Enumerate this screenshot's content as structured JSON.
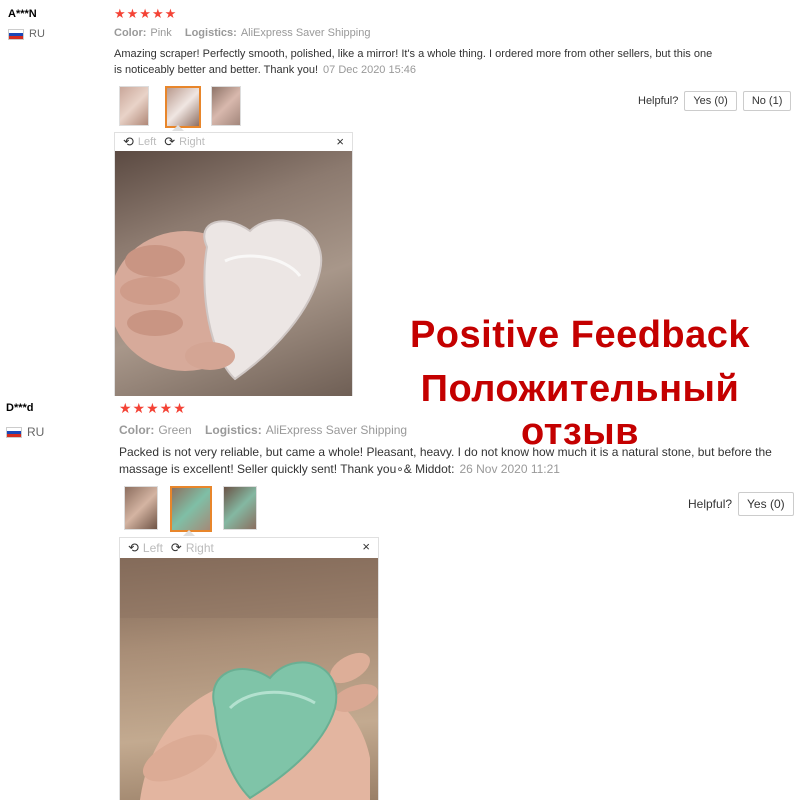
{
  "reviews": [
    {
      "user": "A***N",
      "country": "RU",
      "stars": "★★★★★",
      "color_label": "Color:",
      "color_value": "Pink",
      "logistics_label": "Logistics:",
      "logistics_value": "AliExpress Saver Shipping",
      "text": "Amazing scraper! Perfectly smooth, polished, like a mirror! It's a whole thing. I ordered more from other sellers, but this one is noticeably better and better. Thank you!",
      "date": "07 Dec 2020 15:46",
      "helpful_label": "Helpful?",
      "yes_label": "Yes (0)",
      "no_label": "No (1)",
      "viewer": {
        "left": "Left",
        "right": "Right",
        "close": "×"
      }
    },
    {
      "user": "D***d",
      "country": "RU",
      "stars": "★★★★★",
      "color_label": "Color:",
      "color_value": "Green",
      "logistics_label": "Logistics:",
      "logistics_value": "AliExpress Saver Shipping",
      "text": "Packed is not very reliable, but came a whole! Pleasant, heavy. I do not know how much it is a natural stone, but before the massage is excellent! Seller quickly sent! Thank you∘& Middot:",
      "date": "26 Nov 2020 11:21",
      "helpful_label": "Helpful?",
      "yes_label": "Yes (0)",
      "viewer": {
        "left": "Left",
        "right": "Right",
        "close": "×"
      }
    }
  ],
  "overlay": {
    "line1": "Positive Feedback",
    "line2": "Положительный отзыв"
  },
  "colors": {
    "star": "#f44336",
    "overlay": "#c40000",
    "selected_border": "#e8862b"
  }
}
